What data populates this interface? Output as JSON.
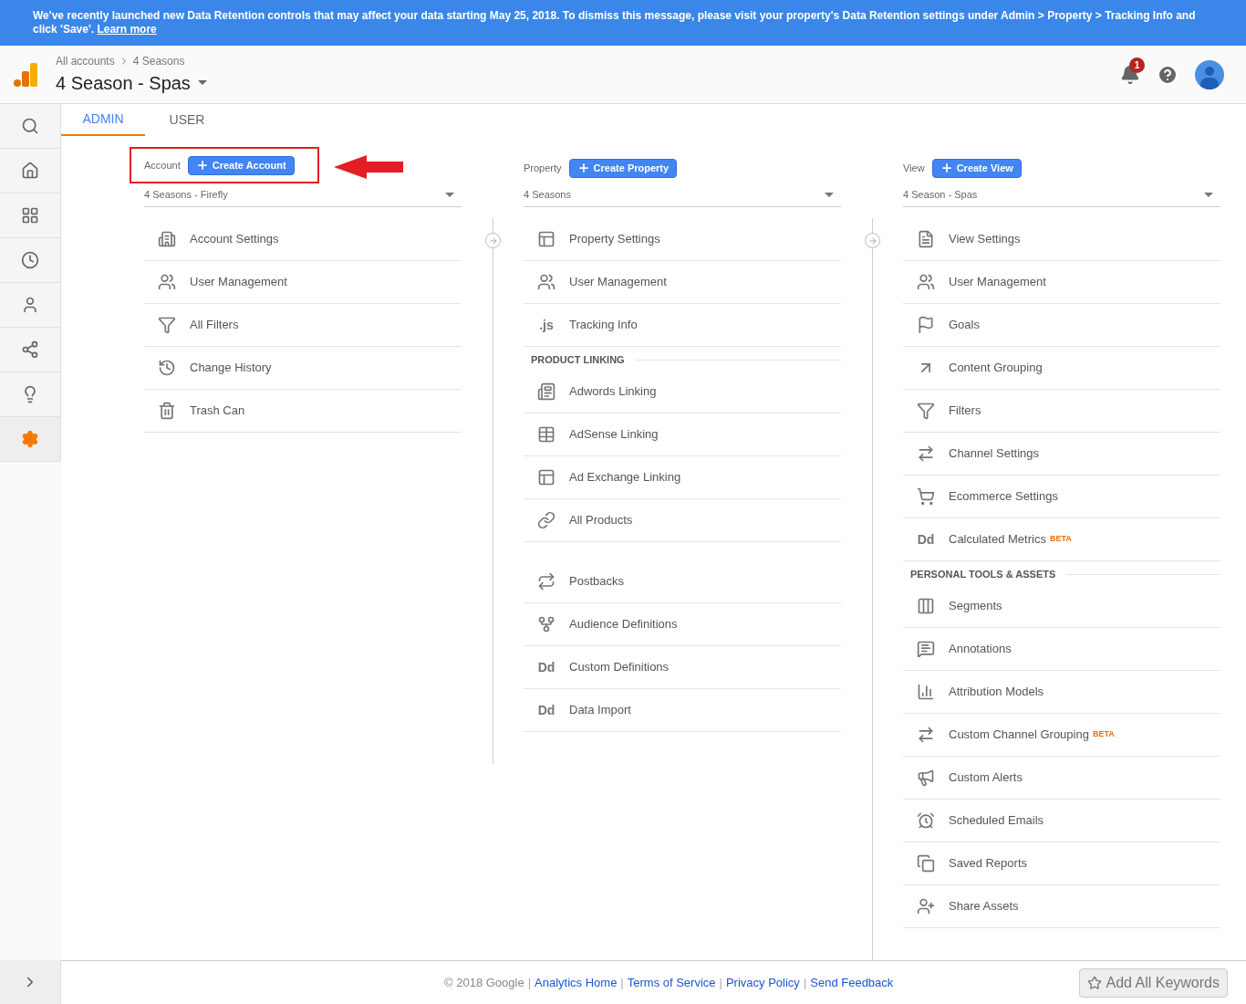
{
  "banner": {
    "text": "We've recently launched new Data Retention controls that may affect your data starting May 25, 2018. To dismiss this message, please visit your property's Data Retention settings under Admin > Property > Tracking Info and click 'Save'.",
    "link": "Learn more"
  },
  "header": {
    "breadcrumb": [
      "All accounts",
      "4 Seasons"
    ],
    "title": "4 Season - Spas",
    "notification_count": "1"
  },
  "sidebar": {
    "items": [
      {
        "selected": false
      },
      {
        "selected": false
      },
      {
        "selected": false
      },
      {
        "selected": false
      },
      {
        "selected": false
      },
      {
        "selected": false
      },
      {
        "selected": false
      },
      {
        "selected": true
      }
    ]
  },
  "tabs": [
    {
      "label": "ADMIN",
      "selected": true
    },
    {
      "label": "USER",
      "selected": false
    }
  ],
  "columns": [
    {
      "label": "Account",
      "button": "Create Account",
      "dropdown": "4 Seasons - Firefly",
      "highlighted": true,
      "sections": [
        {
          "items": [
            {
              "label": "Account Settings"
            },
            {
              "label": "User Management"
            },
            {
              "label": "All Filters"
            },
            {
              "label": "Change History"
            },
            {
              "label": "Trash Can"
            }
          ]
        }
      ]
    },
    {
      "label": "Property",
      "button": "Create Property",
      "dropdown": "4 Seasons",
      "highlighted": false,
      "sections": [
        {
          "items": [
            {
              "label": "Property Settings"
            },
            {
              "label": "User Management"
            },
            {
              "label": "Tracking Info",
              "icon_text": ".js"
            }
          ]
        },
        {
          "heading": "PRODUCT LINKING",
          "items": [
            {
              "label": "Adwords Linking"
            },
            {
              "label": "AdSense Linking"
            },
            {
              "label": "Ad Exchange Linking"
            },
            {
              "label": "All Products"
            }
          ]
        },
        {
          "items": [
            {
              "label": "Postbacks"
            },
            {
              "label": "Audience Definitions"
            },
            {
              "label": "Custom Definitions",
              "icon_text": "Dd"
            },
            {
              "label": "Data Import",
              "icon_text": "Dd"
            }
          ]
        }
      ]
    },
    {
      "label": "View",
      "button": "Create View",
      "dropdown": "4 Season - Spas",
      "highlighted": false,
      "sections": [
        {
          "items": [
            {
              "label": "View Settings"
            },
            {
              "label": "User Management"
            },
            {
              "label": "Goals"
            },
            {
              "label": "Content Grouping"
            },
            {
              "label": "Filters"
            },
            {
              "label": "Channel Settings"
            },
            {
              "label": "Ecommerce Settings"
            },
            {
              "label": "Calculated Metrics",
              "badge": "BETA",
              "icon_text": "Dd"
            }
          ]
        },
        {
          "heading": "PERSONAL TOOLS & ASSETS",
          "items": [
            {
              "label": "Segments"
            },
            {
              "label": "Annotations"
            },
            {
              "label": "Attribution Models"
            },
            {
              "label": "Custom Channel Grouping",
              "badge": "BETA"
            },
            {
              "label": "Custom Alerts"
            },
            {
              "label": "Scheduled Emails"
            },
            {
              "label": "Saved Reports"
            },
            {
              "label": "Share Assets"
            }
          ]
        }
      ]
    }
  ],
  "footer": {
    "copyright": "© 2018 Google",
    "separator": "|",
    "links": [
      "Analytics Home",
      "Terms of Service",
      "Privacy Policy",
      "Send Feedback"
    ],
    "button": "Add All Keywords"
  }
}
